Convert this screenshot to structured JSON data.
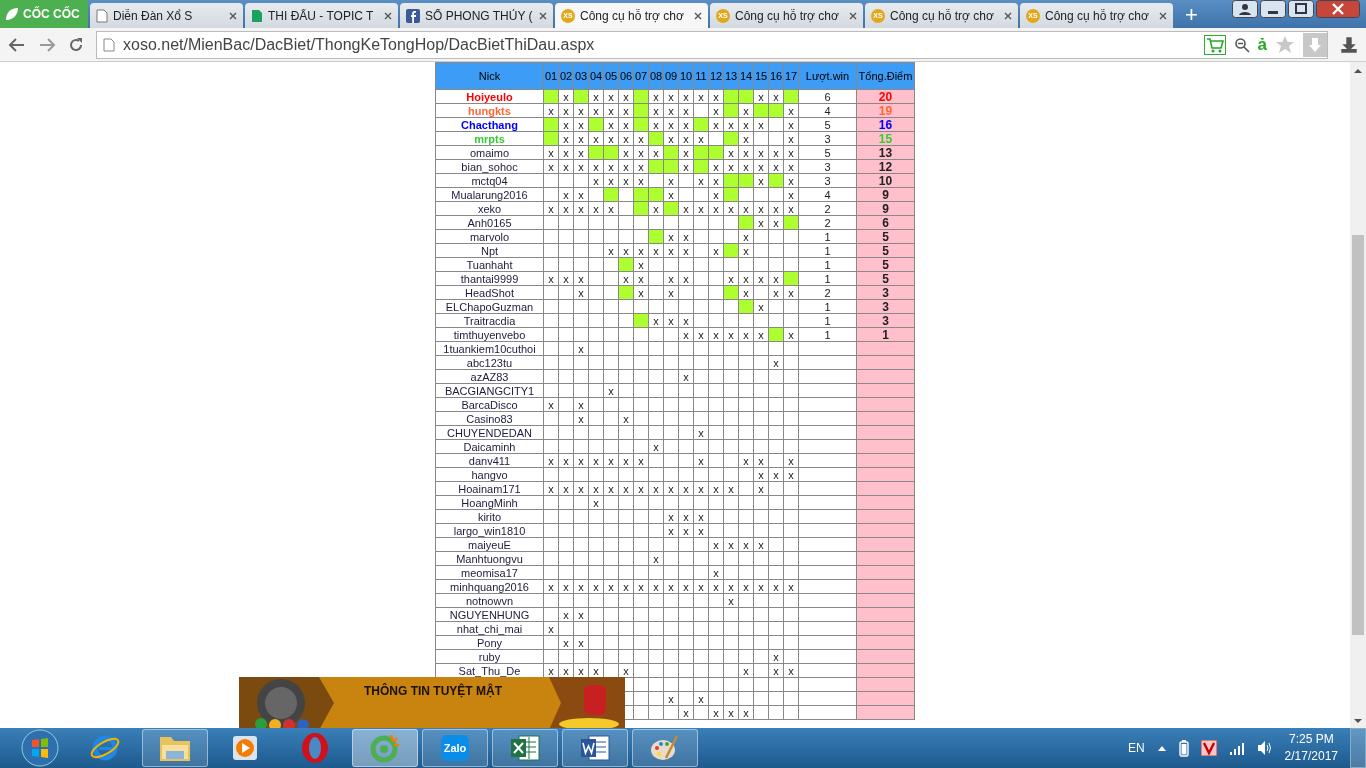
{
  "browser": {
    "logo": "CỐC CỐC",
    "tabs": [
      {
        "kind": "page",
        "title": "Diễn Đàn Xổ S",
        "selected": false
      },
      {
        "kind": "sheet",
        "title": "THI ĐẤU - TOPIC T",
        "selected": false
      },
      {
        "kind": "facebook",
        "title": "SỔ PHONG THỦY (",
        "selected": false
      },
      {
        "kind": "xs",
        "icon_text": "XS",
        "title": "Công cụ hỗ trợ chơ",
        "selected": true
      },
      {
        "kind": "xs",
        "icon_text": "XS",
        "title": "Công cụ hỗ trợ chơ",
        "selected": false
      },
      {
        "kind": "xs",
        "icon_text": "XS",
        "title": "Công cụ hỗ trợ chơ",
        "selected": false
      },
      {
        "kind": "xs",
        "icon_text": "XS",
        "title": "Công cụ hỗ trợ chơ",
        "selected": false
      }
    ],
    "new_tab": "+",
    "address": "xoso.net/MienBac/DacBiet/ThongKeTongHop/DacBietThiDau.aspx",
    "ime": "ả"
  },
  "table": {
    "nick_header": "Nick",
    "round_headers": [
      "01",
      "02",
      "03",
      "04",
      "05",
      "06",
      "07",
      "08",
      "09",
      "10",
      "11",
      "12",
      "13",
      "14",
      "15",
      "16",
      "17"
    ],
    "wins_header": "Lượt.win",
    "points_header": "Tổng.Điểm",
    "rows": [
      {
        "nick": "Hoiyeulo",
        "color": "#ff0000",
        "cells": [
          {
            "win": true
          },
          "x",
          {
            "win": true
          },
          "x",
          "x",
          "x",
          {
            "win": true
          },
          "x",
          "x",
          "x",
          "x",
          "x",
          {
            "win": true
          },
          {
            "win": true
          },
          "x",
          "x",
          {
            "win": true
          }
        ],
        "luot_win": "6",
        "tong_diem": "20"
      },
      {
        "nick": "hungkts",
        "color": "#ff6633",
        "cells": [
          "x",
          "x",
          "x",
          "x",
          "x",
          "x",
          {
            "win": true
          },
          "x",
          "x",
          "x",
          {
            "win": false
          },
          "x",
          {
            "win": true
          },
          "x",
          {
            "win": true
          },
          {
            "win": true
          },
          "x"
        ],
        "luot_win": "4",
        "tong_diem": "19"
      },
      {
        "nick": "Chacthang",
        "color": "#0000ff",
        "cells": [
          {
            "win": true
          },
          "x",
          "x",
          {
            "win": true
          },
          "x",
          "x",
          {
            "win": true
          },
          "x",
          "x",
          "x",
          {
            "win": true
          },
          "x",
          "x",
          "x",
          "x",
          {
            "win": false
          },
          "x"
        ],
        "luot_win": "5",
        "tong_diem": "16"
      },
      {
        "nick": "mrpts",
        "color": "#33cc33",
        "cells": [
          {
            "win": true
          },
          "x",
          "x",
          "x",
          "x",
          "x",
          "x",
          {
            "win": true
          },
          "x",
          "x",
          "x",
          {
            "win": false
          },
          {
            "win": true
          },
          "x",
          {
            "win": false
          },
          {
            "win": false
          },
          "x"
        ],
        "luot_win": "3",
        "tong_diem": "15"
      },
      {
        "nick": "omaimo",
        "cells": [
          "x",
          "x",
          "x",
          {
            "win": true
          },
          {
            "win": true
          },
          "x",
          "x",
          "x",
          {
            "win": true
          },
          "x",
          {
            "win": true
          },
          {
            "win": true
          },
          "x",
          "x",
          "x",
          "x",
          "x"
        ],
        "luot_win": "5",
        "tong_diem": "13"
      },
      {
        "nick": "bian_sohoc",
        "cells": [
          "x",
          "x",
          "x",
          "x",
          "x",
          "x",
          "x",
          {
            "win": true
          },
          {
            "win": true
          },
          "x",
          {
            "win": true
          },
          "x",
          "x",
          "x",
          "x",
          "x",
          "x"
        ],
        "luot_win": "3",
        "tong_diem": "12"
      },
      {
        "nick": "mctq04",
        "cells": [
          {
            "win": false
          },
          {
            "win": false
          },
          {
            "win": false
          },
          "x",
          "x",
          "x",
          "x",
          {
            "win": false
          },
          "x",
          {
            "win": false
          },
          "x",
          "x",
          {
            "win": true
          },
          {
            "win": true
          },
          "x",
          {
            "win": true
          },
          "x"
        ],
        "luot_win": "3",
        "tong_diem": "10"
      },
      {
        "nick": "Mualarung2016",
        "cells": [
          {
            "win": false
          },
          "x",
          "x",
          {
            "win": false
          },
          {
            "win": true
          },
          {
            "win": false
          },
          {
            "win": true
          },
          {
            "win": true
          },
          "x",
          {
            "win": false
          },
          {
            "win": false
          },
          "x",
          {
            "win": true
          },
          {
            "win": false
          },
          {
            "win": false
          },
          {
            "win": false
          },
          "x"
        ],
        "luot_win": "4",
        "tong_diem": "9"
      },
      {
        "nick": "xeko",
        "cells": [
          "x",
          "x",
          "x",
          "x",
          "x",
          {
            "win": false
          },
          {
            "win": true
          },
          "x",
          {
            "win": true
          },
          "x",
          "x",
          "x",
          "x",
          "x",
          "x",
          "x",
          "x"
        ],
        "luot_win": "2",
        "tong_diem": "9"
      },
      {
        "nick": "Anh0165",
        "cells": [
          {
            "win": false
          },
          {
            "win": false
          },
          {
            "win": false
          },
          {
            "win": false
          },
          {
            "win": false
          },
          {
            "win": false
          },
          {
            "win": false
          },
          {
            "win": false
          },
          {
            "win": false
          },
          {
            "win": false
          },
          {
            "win": false
          },
          {
            "win": false
          },
          {
            "win": false
          },
          {
            "win": true
          },
          "x",
          "x",
          {
            "win": true
          }
        ],
        "luot_win": "2",
        "tong_diem": "6"
      },
      {
        "nick": "marvolo",
        "cells": [
          {
            "win": false
          },
          {
            "win": false
          },
          {
            "win": false
          },
          {
            "win": false
          },
          {
            "win": false
          },
          {
            "win": false
          },
          {
            "win": false
          },
          {
            "win": true
          },
          "x",
          "x",
          {
            "win": false
          },
          {
            "win": false
          },
          {
            "win": false
          },
          "x",
          {
            "win": false
          },
          {
            "win": false
          },
          {
            "win": false
          }
        ],
        "luot_win": "1",
        "tong_diem": "5"
      },
      {
        "nick": "Npt",
        "cells": [
          {
            "win": false
          },
          {
            "win": false
          },
          {
            "win": false
          },
          {
            "win": false
          },
          "x",
          "x",
          "x",
          "x",
          "x",
          "x",
          {
            "win": false
          },
          "x",
          {
            "win": true
          },
          "x",
          {
            "win": false
          },
          {
            "win": false
          },
          {
            "win": false
          }
        ],
        "luot_win": "1",
        "tong_diem": "5"
      },
      {
        "nick": "Tuanhaht",
        "cells": [
          {
            "win": false
          },
          {
            "win": false
          },
          {
            "win": false
          },
          {
            "win": false
          },
          {
            "win": false
          },
          {
            "win": true
          },
          "x",
          {
            "win": false
          },
          {
            "win": false
          },
          {
            "win": false
          },
          {
            "win": false
          },
          {
            "win": false
          },
          {
            "win": false
          },
          {
            "win": false
          },
          {
            "win": false
          },
          {
            "win": false
          },
          {
            "win": false
          }
        ],
        "luot_win": "1",
        "tong_diem": "5"
      },
      {
        "nick": "thantai9999",
        "cells": [
          "x",
          "x",
          "x",
          {
            "win": false
          },
          {
            "win": false
          },
          "x",
          "x",
          {
            "win": false
          },
          "x",
          "x",
          {
            "win": false
          },
          {
            "win": false
          },
          "x",
          "x",
          "x",
          "x",
          {
            "win": true
          }
        ],
        "luot_win": "1",
        "tong_diem": "5"
      },
      {
        "nick": "HeadShot",
        "cells": [
          {
            "win": false
          },
          {
            "win": false
          },
          "x",
          {
            "win": false
          },
          {
            "win": false
          },
          {
            "win": true
          },
          "x",
          {
            "win": false
          },
          "x",
          {
            "win": false
          },
          {
            "win": false
          },
          {
            "win": false
          },
          {
            "win": true
          },
          "x",
          {
            "win": false
          },
          "x",
          "x"
        ],
        "luot_win": "2",
        "tong_diem": "3"
      },
      {
        "nick": "ELChapoGuzman",
        "cells": [
          {
            "win": false
          },
          {
            "win": false
          },
          {
            "win": false
          },
          {
            "win": false
          },
          {
            "win": false
          },
          {
            "win": false
          },
          {
            "win": false
          },
          {
            "win": false
          },
          {
            "win": false
          },
          {
            "win": false
          },
          {
            "win": false
          },
          {
            "win": false
          },
          {
            "win": false
          },
          {
            "win": true
          },
          "x",
          {
            "win": false
          },
          {
            "win": false
          }
        ],
        "luot_win": "1",
        "tong_diem": "3"
      },
      {
        "nick": "Traitracdia",
        "cells": [
          {
            "win": false
          },
          {
            "win": false
          },
          {
            "win": false
          },
          {
            "win": false
          },
          {
            "win": false
          },
          {
            "win": false
          },
          {
            "win": true
          },
          "x",
          "x",
          "x",
          {
            "win": false
          },
          {
            "win": false
          },
          {
            "win": false
          },
          {
            "win": false
          },
          {
            "win": false
          },
          {
            "win": false
          },
          {
            "win": false
          }
        ],
        "luot_win": "1",
        "tong_diem": "3"
      },
      {
        "nick": "timthuyenvebo",
        "cells": [
          {
            "win": false
          },
          {
            "win": false
          },
          {
            "win": false
          },
          {
            "win": false
          },
          {
            "win": false
          },
          {
            "win": false
          },
          {
            "win": false
          },
          {
            "win": false
          },
          {
            "win": false
          },
          "x",
          "x",
          "x",
          "x",
          "x",
          "x",
          {
            "win": true
          },
          "x"
        ],
        "luot_win": "1",
        "tong_diem": "1"
      },
      {
        "nick": "1tuankiem10cuthoi",
        "cells": [
          {
            "win": false
          },
          {
            "win": false
          },
          "x",
          {
            "win": false
          },
          {
            "win": false
          },
          {
            "win": false
          },
          {
            "win": false
          },
          {
            "win": false
          },
          {
            "win": false
          },
          {
            "win": false
          },
          {
            "win": false
          },
          {
            "win": false
          },
          {
            "win": false
          },
          {
            "win": false
          },
          {
            "win": false
          },
          {
            "win": false
          },
          {
            "win": false
          }
        ]
      },
      {
        "nick": "abc123tu",
        "cells": [
          {
            "win": false
          },
          {
            "win": false
          },
          {
            "win": false
          },
          {
            "win": false
          },
          {
            "win": false
          },
          {
            "win": false
          },
          {
            "win": false
          },
          {
            "win": false
          },
          {
            "win": false
          },
          {
            "win": false
          },
          {
            "win": false
          },
          {
            "win": false
          },
          {
            "win": false
          },
          {
            "win": false
          },
          {
            "win": false
          },
          "x",
          {
            "win": false
          }
        ]
      },
      {
        "nick": "azAZ83",
        "cells": [
          {
            "win": false
          },
          {
            "win": false
          },
          {
            "win": false
          },
          {
            "win": false
          },
          {
            "win": false
          },
          {
            "win": false
          },
          {
            "win": false
          },
          {
            "win": false
          },
          {
            "win": false
          },
          "x",
          {
            "win": false
          },
          {
            "win": false
          },
          {
            "win": false
          },
          {
            "win": false
          },
          {
            "win": false
          },
          {
            "win": false
          },
          {
            "win": false
          }
        ]
      },
      {
        "nick": "BACGIANGCITY1",
        "cells": [
          {
            "win": false
          },
          {
            "win": false
          },
          {
            "win": false
          },
          {
            "win": false
          },
          "x",
          {
            "win": false
          },
          {
            "win": false
          },
          {
            "win": false
          },
          {
            "win": false
          },
          {
            "win": false
          },
          {
            "win": false
          },
          {
            "win": false
          },
          {
            "win": false
          },
          {
            "win": false
          },
          {
            "win": false
          },
          {
            "win": false
          },
          {
            "win": false
          }
        ]
      },
      {
        "nick": "BarcaDisco",
        "cells": [
          "x",
          {
            "win": false
          },
          "x",
          {
            "win": false
          },
          {
            "win": false
          },
          {
            "win": false
          },
          {
            "win": false
          },
          {
            "win": false
          },
          {
            "win": false
          },
          {
            "win": false
          },
          {
            "win": false
          },
          {
            "win": false
          },
          {
            "win": false
          },
          {
            "win": false
          },
          {
            "win": false
          },
          {
            "win": false
          },
          {
            "win": false
          }
        ]
      },
      {
        "nick": "Casino83",
        "cells": [
          {
            "win": false
          },
          {
            "win": false
          },
          "x",
          {
            "win": false
          },
          {
            "win": false
          },
          "x",
          {
            "win": false
          },
          {
            "win": false
          },
          {
            "win": false
          },
          {
            "win": false
          },
          {
            "win": false
          },
          {
            "win": false
          },
          {
            "win": false
          },
          {
            "win": false
          },
          {
            "win": false
          },
          {
            "win": false
          },
          {
            "win": false
          }
        ]
      },
      {
        "nick": "CHUYENDEDAN",
        "cells": [
          {
            "win": false
          },
          {
            "win": false
          },
          {
            "win": false
          },
          {
            "win": false
          },
          {
            "win": false
          },
          {
            "win": false
          },
          {
            "win": false
          },
          {
            "win": false
          },
          {
            "win": false
          },
          {
            "win": false
          },
          "x",
          {
            "win": false
          },
          {
            "win": false
          },
          {
            "win": false
          },
          {
            "win": false
          },
          {
            "win": false
          },
          {
            "win": false
          }
        ]
      },
      {
        "nick": "Daicaminh",
        "cells": [
          {
            "win": false
          },
          {
            "win": false
          },
          {
            "win": false
          },
          {
            "win": false
          },
          {
            "win": false
          },
          {
            "win": false
          },
          {
            "win": false
          },
          "x",
          {
            "win": false
          },
          {
            "win": false
          },
          {
            "win": false
          },
          {
            "win": false
          },
          {
            "win": false
          },
          {
            "win": false
          },
          {
            "win": false
          },
          {
            "win": false
          },
          {
            "win": false
          }
        ]
      },
      {
        "nick": "danv411",
        "cells": [
          "x",
          "x",
          "x",
          "x",
          "x",
          "x",
          "x",
          {
            "win": false
          },
          {
            "win": false
          },
          {
            "win": false
          },
          "x",
          {
            "win": false
          },
          {
            "win": false
          },
          "x",
          "x",
          {
            "win": false
          },
          "x"
        ]
      },
      {
        "nick": "hangvo",
        "cells": [
          {
            "win": false
          },
          {
            "win": false
          },
          {
            "win": false
          },
          {
            "win": false
          },
          {
            "win": false
          },
          {
            "win": false
          },
          {
            "win": false
          },
          {
            "win": false
          },
          {
            "win": false
          },
          {
            "win": false
          },
          {
            "win": false
          },
          {
            "win": false
          },
          {
            "win": false
          },
          {
            "win": false
          },
          "x",
          "x",
          "x"
        ]
      },
      {
        "nick": "Hoainam171",
        "cells": [
          "x",
          "x",
          "x",
          "x",
          "x",
          "x",
          "x",
          "x",
          "x",
          "x",
          "x",
          "x",
          "x",
          {
            "win": false
          },
          "x",
          {
            "win": false
          },
          {
            "win": false
          }
        ]
      },
      {
        "nick": "HoangMinh",
        "cells": [
          {
            "win": false
          },
          {
            "win": false
          },
          {
            "win": false
          },
          "x",
          {
            "win": false
          },
          {
            "win": false
          },
          {
            "win": false
          },
          {
            "win": false
          },
          {
            "win": false
          },
          {
            "win": false
          },
          {
            "win": false
          },
          {
            "win": false
          },
          {
            "win": false
          },
          {
            "win": false
          },
          {
            "win": false
          },
          {
            "win": false
          },
          {
            "win": false
          }
        ]
      },
      {
        "nick": "kirito",
        "cells": [
          {
            "win": false
          },
          {
            "win": false
          },
          {
            "win": false
          },
          {
            "win": false
          },
          {
            "win": false
          },
          {
            "win": false
          },
          {
            "win": false
          },
          {
            "win": false
          },
          "x",
          "x",
          "x",
          {
            "win": false
          },
          {
            "win": false
          },
          {
            "win": false
          },
          {
            "win": false
          },
          {
            "win": false
          },
          {
            "win": false
          }
        ]
      },
      {
        "nick": "largo_win1810",
        "cells": [
          {
            "win": false
          },
          {
            "win": false
          },
          {
            "win": false
          },
          {
            "win": false
          },
          {
            "win": false
          },
          {
            "win": false
          },
          {
            "win": false
          },
          {
            "win": false
          },
          "x",
          "x",
          "x",
          {
            "win": false
          },
          {
            "win": false
          },
          {
            "win": false
          },
          {
            "win": false
          },
          {
            "win": false
          },
          {
            "win": false
          }
        ]
      },
      {
        "nick": "maiyeuE",
        "cells": [
          {
            "win": false
          },
          {
            "win": false
          },
          {
            "win": false
          },
          {
            "win": false
          },
          {
            "win": false
          },
          {
            "win": false
          },
          {
            "win": false
          },
          {
            "win": false
          },
          {
            "win": false
          },
          {
            "win": false
          },
          {
            "win": false
          },
          "x",
          "x",
          "x",
          "x",
          {
            "win": false
          },
          {
            "win": false
          }
        ]
      },
      {
        "nick": "Manhtuongvu",
        "cells": [
          {
            "win": false
          },
          {
            "win": false
          },
          {
            "win": false
          },
          {
            "win": false
          },
          {
            "win": false
          },
          {
            "win": false
          },
          {
            "win": false
          },
          "x",
          {
            "win": false
          },
          {
            "win": false
          },
          {
            "win": false
          },
          {
            "win": false
          },
          {
            "win": false
          },
          {
            "win": false
          },
          {
            "win": false
          },
          {
            "win": false
          },
          {
            "win": false
          }
        ]
      },
      {
        "nick": "meomisa17",
        "cells": [
          {
            "win": false
          },
          {
            "win": false
          },
          {
            "win": false
          },
          {
            "win": false
          },
          {
            "win": false
          },
          {
            "win": false
          },
          {
            "win": false
          },
          {
            "win": false
          },
          {
            "win": false
          },
          {
            "win": false
          },
          {
            "win": false
          },
          "x",
          {
            "win": false
          },
          {
            "win": false
          },
          {
            "win": false
          },
          {
            "win": false
          },
          {
            "win": false
          }
        ]
      },
      {
        "nick": "minhquang2016",
        "cells": [
          "x",
          "x",
          "x",
          "x",
          "x",
          "x",
          "x",
          "x",
          "x",
          "x",
          "x",
          "x",
          "x",
          "x",
          "x",
          "x",
          "x"
        ]
      },
      {
        "nick": "notnowvn",
        "cells": [
          {
            "win": false
          },
          {
            "win": false
          },
          {
            "win": false
          },
          {
            "win": false
          },
          {
            "win": false
          },
          {
            "win": false
          },
          {
            "win": false
          },
          {
            "win": false
          },
          {
            "win": false
          },
          {
            "win": false
          },
          {
            "win": false
          },
          {
            "win": false
          },
          "x",
          {
            "win": false
          },
          {
            "win": false
          },
          {
            "win": false
          },
          {
            "win": false
          }
        ]
      },
      {
        "nick": "NGUYENHUNG",
        "cells": [
          {
            "win": false
          },
          "x",
          "x",
          {
            "win": false
          },
          {
            "win": false
          },
          {
            "win": false
          },
          {
            "win": false
          },
          {
            "win": false
          },
          {
            "win": false
          },
          {
            "win": false
          },
          {
            "win": false
          },
          {
            "win": false
          },
          {
            "win": false
          },
          {
            "win": false
          },
          {
            "win": false
          },
          {
            "win": false
          },
          {
            "win": false
          }
        ]
      },
      {
        "nick": "nhat_chi_mai",
        "cells": [
          "x",
          {
            "win": false
          },
          {
            "win": false
          },
          {
            "win": false
          },
          {
            "win": false
          },
          {
            "win": false
          },
          {
            "win": false
          },
          {
            "win": false
          },
          {
            "win": false
          },
          {
            "win": false
          },
          {
            "win": false
          },
          {
            "win": false
          },
          {
            "win": false
          },
          {
            "win": false
          },
          {
            "win": false
          },
          {
            "win": false
          },
          {
            "win": false
          }
        ]
      },
      {
        "nick": "Pony",
        "cells": [
          {
            "win": false
          },
          "x",
          "x",
          {
            "win": false
          },
          {
            "win": false
          },
          {
            "win": false
          },
          {
            "win": false
          },
          {
            "win": false
          },
          {
            "win": false
          },
          {
            "win": false
          },
          {
            "win": false
          },
          {
            "win": false
          },
          {
            "win": false
          },
          {
            "win": false
          },
          {
            "win": false
          },
          {
            "win": false
          },
          {
            "win": false
          }
        ]
      },
      {
        "nick": "ruby",
        "cells": [
          {
            "win": false
          },
          {
            "win": false
          },
          {
            "win": false
          },
          {
            "win": false
          },
          {
            "win": false
          },
          {
            "win": false
          },
          {
            "win": false
          },
          {
            "win": false
          },
          {
            "win": false
          },
          {
            "win": false
          },
          {
            "win": false
          },
          {
            "win": false
          },
          {
            "win": false
          },
          {
            "win": false
          },
          {
            "win": false
          },
          "x",
          {
            "win": false
          }
        ]
      },
      {
        "nick": "Sat_Thu_De",
        "cells": [
          "x",
          "x",
          "x",
          "x",
          {
            "win": false
          },
          "x",
          {
            "win": false
          },
          {
            "win": false
          },
          {
            "win": false
          },
          {
            "win": false
          },
          {
            "win": false
          },
          {
            "win": false
          },
          {
            "win": false
          },
          "x",
          {
            "win": false
          },
          "x",
          "x"
        ]
      },
      {
        "cells": [
          null,
          null,
          null,
          null,
          null,
          {
            "win": false
          },
          {
            "win": false
          },
          {
            "win": false
          },
          {
            "win": false
          },
          {
            "win": false
          },
          {
            "win": false
          },
          {
            "win": false
          },
          {
            "win": false
          },
          {
            "win": false
          },
          {
            "win": false
          },
          {
            "win": false
          },
          {
            "win": false
          }
        ]
      },
      {
        "cells": [
          null,
          null,
          null,
          null,
          null,
          {
            "win": false
          },
          {
            "win": false
          },
          {
            "win": false
          },
          "x",
          {
            "win": false
          },
          "x",
          {
            "win": false
          },
          {
            "win": false
          },
          {
            "win": false
          },
          {
            "win": false
          },
          {
            "win": false
          },
          {
            "win": false
          }
        ]
      },
      {
        "cells": [
          null,
          null,
          null,
          null,
          null,
          {
            "win": false
          },
          {
            "win": false
          },
          {
            "win": false
          },
          {
            "win": false
          },
          "x",
          {
            "win": false
          },
          "x",
          "x",
          "x",
          {
            "win": false
          },
          {
            "win": false
          },
          {
            "win": false
          }
        ]
      }
    ]
  },
  "ad_banner": {
    "title": "THÔNG TIN TUYỆT MẬT"
  },
  "taskbar": {
    "apps": [
      {
        "kind": "ie",
        "selected": false
      },
      {
        "kind": "folder",
        "selected": false
      },
      {
        "kind": "media",
        "selected": false
      },
      {
        "kind": "opera",
        "selected": false
      },
      {
        "kind": "coccoc",
        "selected": true
      },
      {
        "kind": "zalo",
        "label": "Zalo",
        "selected": false
      },
      {
        "kind": "excel",
        "selected": false
      },
      {
        "kind": "word",
        "selected": false
      },
      {
        "kind": "paint",
        "selected": false
      }
    ],
    "language": "EN",
    "time": "7:25 PM",
    "date": "2/17/2017"
  }
}
